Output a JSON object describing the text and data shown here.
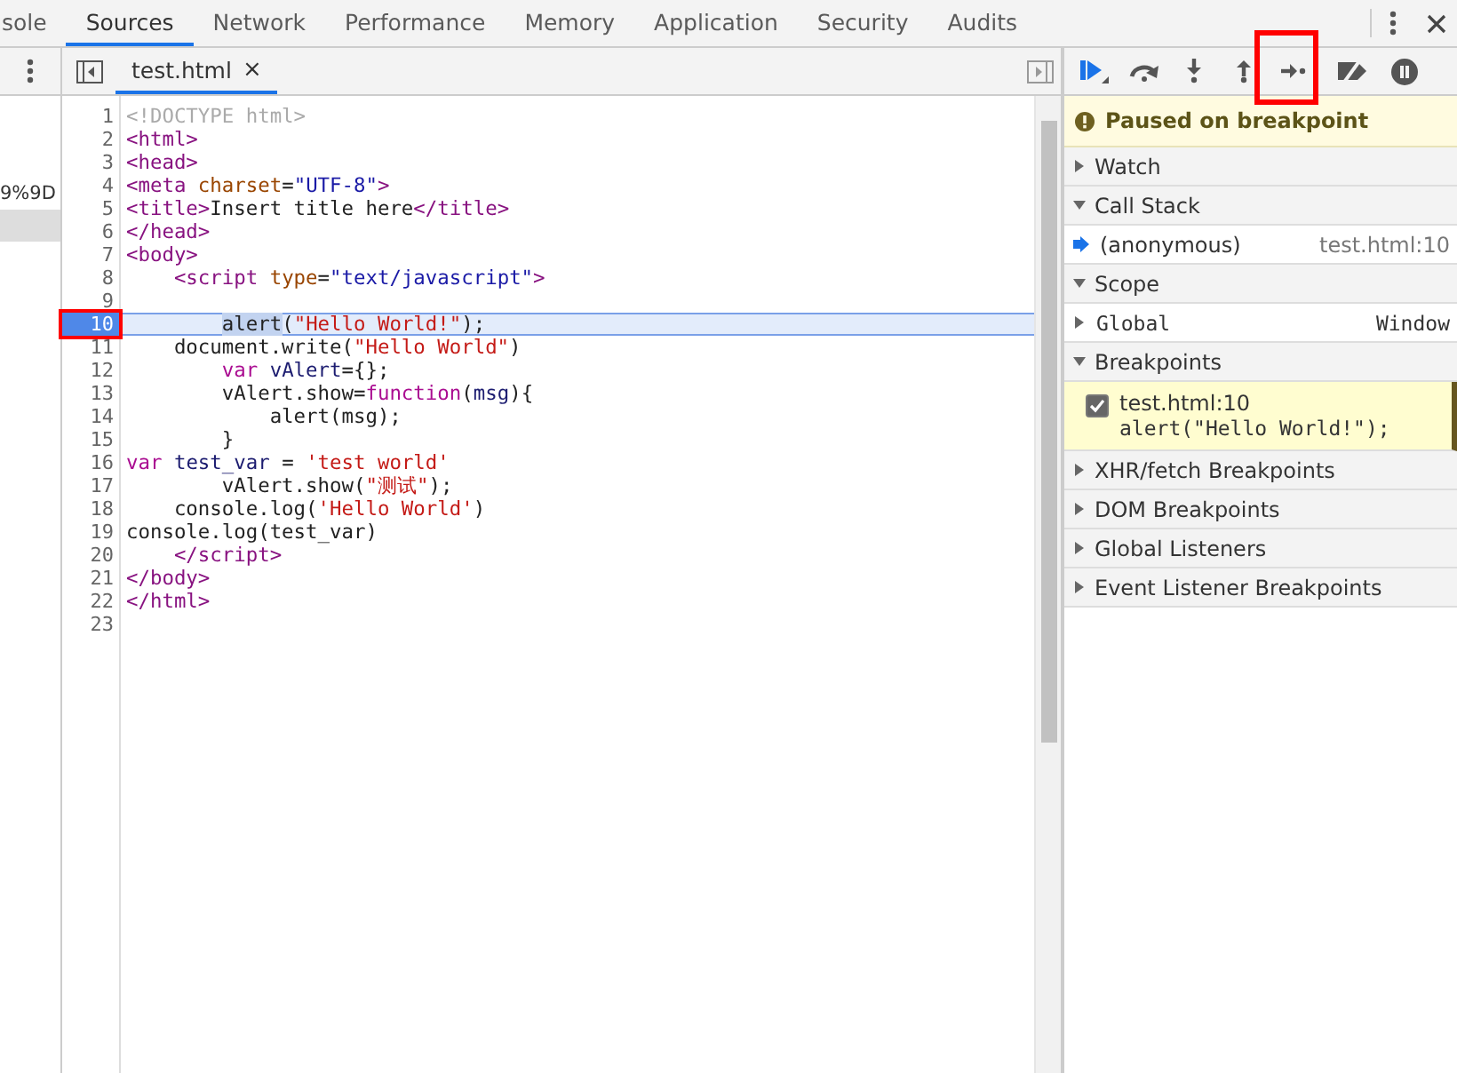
{
  "tabs": [
    {
      "label": "sole",
      "selected": false
    },
    {
      "label": "Sources",
      "selected": true
    },
    {
      "label": "Network",
      "selected": false
    },
    {
      "label": "Performance",
      "selected": false
    },
    {
      "label": "Memory",
      "selected": false
    },
    {
      "label": "Application",
      "selected": false
    },
    {
      "label": "Security",
      "selected": false
    },
    {
      "label": "Audits",
      "selected": false
    }
  ],
  "navigator": {
    "items": [
      {
        "label": "9%9D",
        "selected": false
      },
      {
        "selected": true
      }
    ]
  },
  "editor": {
    "file_tab": {
      "label": "test.html",
      "close": "×"
    },
    "lines": [
      {
        "number": "1",
        "execution": false,
        "breakpoint": false,
        "tokens": [
          {
            "kind": "comment",
            "text": "<!DOCTYPE html>"
          }
        ]
      },
      {
        "number": "2",
        "execution": false,
        "breakpoint": false,
        "tokens": [
          {
            "kind": "tag",
            "text": "<html>"
          }
        ]
      },
      {
        "number": "3",
        "execution": false,
        "breakpoint": false,
        "tokens": [
          {
            "kind": "tag",
            "text": "<head>"
          }
        ]
      },
      {
        "number": "4",
        "execution": false,
        "breakpoint": false,
        "tokens": [
          {
            "kind": "tag",
            "text": "<meta "
          },
          {
            "kind": "attr",
            "text": "charset"
          },
          {
            "kind": "plain",
            "text": "="
          },
          {
            "kind": "value",
            "text": "\"UTF-8\""
          },
          {
            "kind": "tag",
            "text": ">"
          }
        ]
      },
      {
        "number": "5",
        "execution": false,
        "breakpoint": false,
        "tokens": [
          {
            "kind": "tag",
            "text": "<title>"
          },
          {
            "kind": "plain",
            "text": "Insert title here"
          },
          {
            "kind": "tag",
            "text": "</title>"
          }
        ]
      },
      {
        "number": "6",
        "execution": false,
        "breakpoint": false,
        "tokens": [
          {
            "kind": "tag",
            "text": "</head>"
          }
        ]
      },
      {
        "number": "7",
        "execution": false,
        "breakpoint": false,
        "tokens": [
          {
            "kind": "tag",
            "text": "<body>"
          }
        ]
      },
      {
        "number": "8",
        "execution": false,
        "breakpoint": false,
        "tokens": [
          {
            "kind": "tag",
            "text": "    <script "
          },
          {
            "kind": "attr",
            "text": "type"
          },
          {
            "kind": "plain",
            "text": "="
          },
          {
            "kind": "value",
            "text": "\"text/javascript\""
          },
          {
            "kind": "tag",
            "text": ">"
          }
        ]
      },
      {
        "number": "9",
        "execution": false,
        "breakpoint": false
      },
      {
        "number": "10",
        "execution": true,
        "breakpoint": true,
        "tokens": [
          {
            "kind": "selected",
            "text": "        alert"
          },
          {
            "kind": "plain",
            "text": "("
          },
          {
            "kind": "string",
            "text": "\"Hello World!\""
          },
          {
            "kind": "plain",
            "text": ");"
          }
        ]
      },
      {
        "number": "11",
        "execution": false,
        "breakpoint": false,
        "tokens": [
          {
            "kind": "plain",
            "text": "    document.write("
          },
          {
            "kind": "string",
            "text": "\"Hello World\""
          },
          {
            "kind": "plain",
            "text": ")"
          }
        ]
      },
      {
        "number": "12",
        "execution": false,
        "breakpoint": false,
        "tokens": [
          {
            "kind": "keyword",
            "text": "        var "
          },
          {
            "kind": "variable",
            "text": "vAlert"
          },
          {
            "kind": "plain",
            "text": "={};"
          }
        ]
      },
      {
        "number": "13",
        "execution": false,
        "breakpoint": false,
        "tokens": [
          {
            "kind": "plain",
            "text": "        vAlert.show="
          },
          {
            "kind": "keyword",
            "text": "function"
          },
          {
            "kind": "plain",
            "text": "("
          },
          {
            "kind": "variable",
            "text": "msg"
          },
          {
            "kind": "plain",
            "text": "){"
          }
        ]
      },
      {
        "number": "14",
        "execution": false,
        "breakpoint": false,
        "tokens": [
          {
            "kind": "plain",
            "text": "            alert(msg);"
          }
        ]
      },
      {
        "number": "15",
        "execution": false,
        "breakpoint": false,
        "tokens": [
          {
            "kind": "plain",
            "text": "        }"
          }
        ]
      },
      {
        "number": "16",
        "execution": false,
        "breakpoint": false,
        "tokens": [
          {
            "kind": "keyword",
            "text": "var "
          },
          {
            "kind": "variable",
            "text": "test_var"
          },
          {
            "kind": "plain",
            "text": " = "
          },
          {
            "kind": "string",
            "text": "'test world'"
          }
        ]
      },
      {
        "number": "17",
        "execution": false,
        "breakpoint": false,
        "tokens": [
          {
            "kind": "plain",
            "text": "        vAlert.show("
          },
          {
            "kind": "string",
            "text": "\"测试\""
          },
          {
            "kind": "plain",
            "text": ");"
          }
        ]
      },
      {
        "number": "18",
        "execution": false,
        "breakpoint": false,
        "tokens": [
          {
            "kind": "plain",
            "text": "    console.log("
          },
          {
            "kind": "string",
            "text": "'Hello World'"
          },
          {
            "kind": "plain",
            "text": ")"
          }
        ]
      },
      {
        "number": "19",
        "execution": false,
        "breakpoint": false,
        "tokens": [
          {
            "kind": "plain",
            "text": "console.log(test_var)"
          }
        ]
      },
      {
        "number": "20",
        "execution": false,
        "breakpoint": false,
        "tokens": [
          {
            "kind": "tag",
            "text": "    </script>"
          }
        ]
      },
      {
        "number": "21",
        "execution": false,
        "breakpoint": false,
        "tokens": [
          {
            "kind": "tag",
            "text": "</body>"
          }
        ]
      },
      {
        "number": "22",
        "execution": false,
        "breakpoint": false,
        "tokens": [
          {
            "kind": "tag",
            "text": "</html>"
          }
        ]
      },
      {
        "number": "23",
        "execution": false,
        "breakpoint": false
      }
    ]
  },
  "debugger": {
    "paused_message": "Paused on breakpoint",
    "sections": [
      {
        "title": "Watch",
        "expanded": false
      },
      {
        "title": "Call Stack",
        "expanded": true,
        "kind": "stack",
        "frames": [
          {
            "name": "(anonymous)",
            "location": "test.html:10"
          }
        ]
      },
      {
        "title": "Scope",
        "expanded": true,
        "kind": "scope",
        "scopes": [
          {
            "name": "Global",
            "value": "Window"
          }
        ]
      },
      {
        "title": "Breakpoints",
        "expanded": true,
        "kind": "breakpoints",
        "breakpoints": [
          {
            "file": "test.html:10",
            "code": "alert(\"Hello World!\");",
            "checked": true
          }
        ]
      },
      {
        "title": "XHR/fetch Breakpoints",
        "expanded": false
      },
      {
        "title": "DOM Breakpoints",
        "expanded": false
      },
      {
        "title": "Global Listeners",
        "expanded": false
      },
      {
        "title": "Event Listener Breakpoints",
        "expanded": false
      }
    ]
  }
}
